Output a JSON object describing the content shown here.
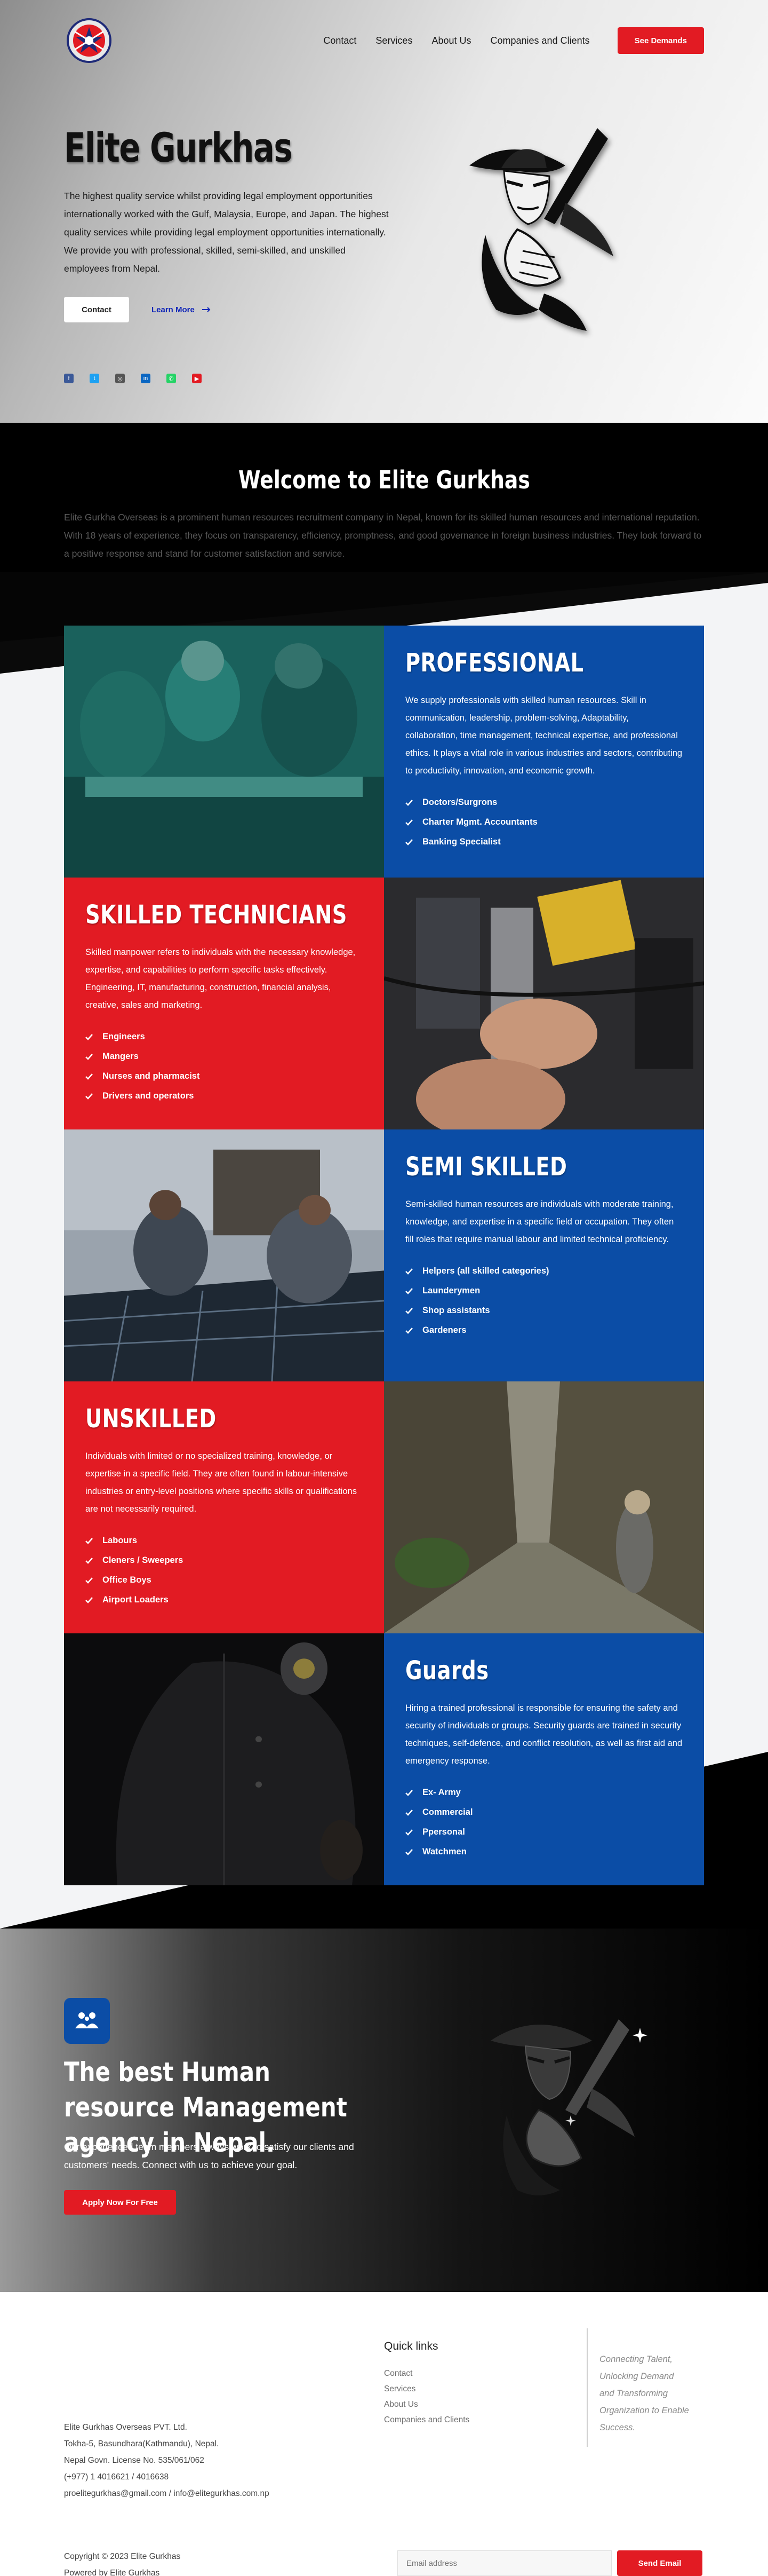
{
  "nav": {
    "items": [
      "Contact",
      "Services",
      "About Us",
      "Companies and Clients"
    ],
    "cta": "See Demands"
  },
  "hero": {
    "title": "Elite Gurkhas",
    "text": "The highest quality service whilst providing legal employment opportunities internationally worked with the Gulf, Malaysia, Europe, and Japan. The highest quality services while providing legal employment opportunities internationally. We provide you with professional, skilled, semi-skilled, and unskilled employees from Nepal.",
    "contact_button": "Contact",
    "learn_more": "Learn More"
  },
  "socials": [
    "facebook-icon",
    "twitter-icon",
    "instagram-icon",
    "linkedin-icon",
    "whatsapp-icon",
    "youtube-icon"
  ],
  "welcome": {
    "title": "Welcome to Elite Gurkhas",
    "text": "Elite Gurkha Overseas is a prominent human resources recruitment company in Nepal, known for its skilled human resources and international reputation. With 18 years of experience, they focus on transparency, efficiency, promptness, and good governance in foreign business industries. They look forward to a positive response and stand for customer satisfaction and service."
  },
  "services": [
    {
      "title": "PROFESSIONAL",
      "text": "We supply professionals with skilled human resources. Skill in communication, leadership, problem-solving, Adaptability, collaboration, time management, technical expertise, and professional ethics. It plays a vital role in various industries and sectors, contributing to productivity, innovation, and economic growth.",
      "items": [
        "Doctors/Surgrons",
        "Charter Mgmt. Accountants",
        "Banking Specialist"
      ]
    },
    {
      "title": "SKILLED TECHNICIANS",
      "text": "Skilled manpower refers to individuals with the necessary knowledge, expertise, and capabilities to perform specific tasks effectively. Engineering, IT, manufacturing, construction, financial analysis, creative, sales and marketing.",
      "items": [
        "Engineers",
        "Mangers",
        "Nurses and pharmacist",
        "Drivers and operators"
      ]
    },
    {
      "title": "SEMI SKILLED",
      "text": "Semi-skilled human resources are individuals with moderate training, knowledge, and expertise in a specific field or occupation. They often fill roles that require manual labour and limited technical proficiency.",
      "items": [
        "Helpers (all skilled categories)",
        "Launderymen",
        "Shop assistants",
        "Gardeners"
      ]
    },
    {
      "title": "UNSKILLED",
      "text": "Individuals with limited or no specialized training, knowledge, or expertise in a specific field. They are often found in labour-intensive industries or entry-level positions where specific skills or qualifications are not necessarily required.",
      "items": [
        "Labours",
        "Cleners / Sweepers",
        "Office Boys",
        "Airport Loaders"
      ]
    },
    {
      "title": "Guards",
      "text": "Hiring a trained professional is responsible for ensuring the safety and security of individuals or groups. Security guards are trained in security techniques, self-defence, and conflict resolution, as well as first aid and emergency response.",
      "items": [
        "Ex- Army",
        "Commercial",
        "Ppersonal",
        "Watchmen"
      ]
    }
  ],
  "cta": {
    "title": "The best Human resource Management agency in Nepal.",
    "text": "Our experienced team members always work to satisfy our clients and customers' needs. Connect with us to achieve your goal.",
    "button": "Apply Now For Free"
  },
  "footer": {
    "quick_links_title": "Quick links",
    "quick_links": [
      "Contact",
      "Services",
      "About Us",
      "Companies and Clients"
    ],
    "quote": "Connecting Talent, Unlocking Demand and Transforming Organization to Enable Success.",
    "address": [
      "Elite Gurkhas Overseas PVT. Ltd.",
      "Tokha-5, Basundhara(Kathmandu), Nepal.",
      "Nepal Govn. License No. 535/061/062",
      "(+977) 1 4016621 / 4016638",
      "proelitegurkhas@gmail.com / info@elitegurkhas.com.np"
    ],
    "copyright": "Copyright © 2023 Elite Gurkhas",
    "powered": "Powered by Elite Gurkhas",
    "email_placeholder": "Email address",
    "send_button": "Send Email"
  },
  "colors": {
    "brand_red": "#e21b23",
    "brand_blue": "#0b4da6",
    "link_blue": "#1328b8"
  }
}
